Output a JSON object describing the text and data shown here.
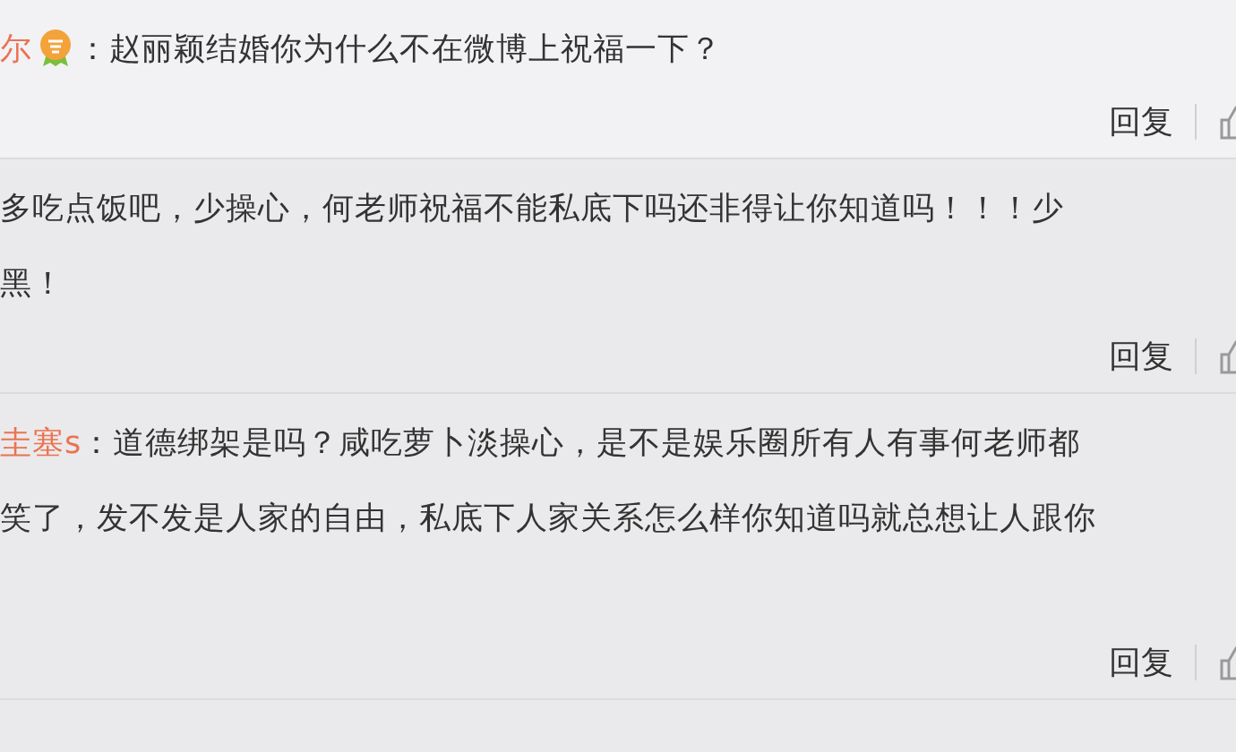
{
  "comments": [
    {
      "username": "尔",
      "badge": true,
      "lines": [
        "：赵丽颖结婚你为什么不在微博上祝福一下？"
      ],
      "reply": "回复",
      "extra_space": false
    },
    {
      "badge": false,
      "lines": [
        "多吃点饭吧，少操心，何老师祝福不能私底下吗还非得让你知道吗！！！少",
        "黑！"
      ],
      "reply": "回复",
      "extra_space": false
    },
    {
      "username": "圭塞s",
      "badge": false,
      "lines": [
        "：道德绑架是吗？咸吃萝卜淡操心，是不是娱乐圈所有人有事何老师都",
        "笑了，发不发是人家的自由，私底下人家关系怎么样你知道吗就总想让人跟你"
      ],
      "reply": "回复",
      "extra_space": true
    }
  ]
}
